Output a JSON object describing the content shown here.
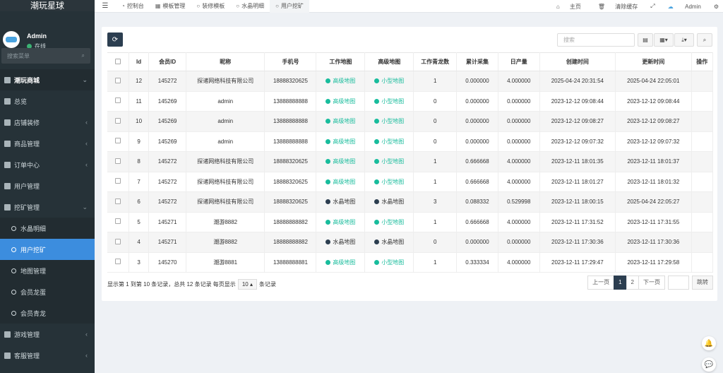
{
  "sidebar": {
    "logo": "潮玩星球",
    "user_name": "Admin",
    "user_status": "在线",
    "search_placeholder": "搜索菜单",
    "items": [
      {
        "label": "潮玩商城",
        "type": "head"
      },
      {
        "label": "总览",
        "type": "item"
      },
      {
        "label": "店铺装修",
        "type": "item"
      },
      {
        "label": "商品管理",
        "type": "item"
      },
      {
        "label": "订单中心",
        "type": "item"
      },
      {
        "label": "用户管理",
        "type": "item"
      },
      {
        "label": "挖矿管理",
        "type": "item"
      },
      {
        "label": "水晶明细",
        "type": "sub"
      },
      {
        "label": "用户挖矿",
        "type": "sub-active"
      },
      {
        "label": "地图管理",
        "type": "sub"
      },
      {
        "label": "会员龙蛋",
        "type": "sub"
      },
      {
        "label": "会员青龙",
        "type": "sub"
      },
      {
        "label": "游戏管理",
        "type": "item"
      },
      {
        "label": "客服管理",
        "type": "item"
      }
    ]
  },
  "topbar": {
    "tabs": [
      "控制台",
      "模板管理",
      "装修模板",
      "水晶明细",
      "用户挖矿"
    ],
    "home": "主页",
    "clear_cache": "清除缓存",
    "admin": "Admin"
  },
  "toolbar": {
    "search_placeholder": "搜索"
  },
  "table": {
    "headers": [
      "Id",
      "会员ID",
      "昵称",
      "手机号",
      "工作地图",
      "高级地图",
      "工作青龙数",
      "累计采集",
      "日产量",
      "创建时间",
      "更新时间",
      "操作"
    ],
    "rows": [
      {
        "id": "12",
        "member": "145272",
        "nick": "探诸网络科技有限公司",
        "phone": "18888320625",
        "work_map": "高级地图",
        "work_map_color": "green",
        "adv_map": "小型地图",
        "adv_map_color": "green",
        "count": "1",
        "total": "0.000000",
        "daily": "4.000000",
        "created": "2025-04-24 20:31:54",
        "updated": "2025-04-24 22:05:01"
      },
      {
        "id": "11",
        "member": "145269",
        "nick": "admin",
        "phone": "13888888888",
        "work_map": "高级地图",
        "work_map_color": "green",
        "adv_map": "小型地图",
        "adv_map_color": "green",
        "count": "0",
        "total": "0.000000",
        "daily": "0.000000",
        "created": "2023-12-12 09:08:44",
        "updated": "2023-12-12 09:08:44"
      },
      {
        "id": "10",
        "member": "145269",
        "nick": "admin",
        "phone": "13888888888",
        "work_map": "高级地图",
        "work_map_color": "green",
        "adv_map": "小型地图",
        "adv_map_color": "green",
        "count": "0",
        "total": "0.000000",
        "daily": "0.000000",
        "created": "2023-12-12 09:08:27",
        "updated": "2023-12-12 09:08:27"
      },
      {
        "id": "9",
        "member": "145269",
        "nick": "admin",
        "phone": "13888888888",
        "work_map": "高级地图",
        "work_map_color": "green",
        "adv_map": "小型地图",
        "adv_map_color": "green",
        "count": "0",
        "total": "0.000000",
        "daily": "0.000000",
        "created": "2023-12-12 09:07:32",
        "updated": "2023-12-12 09:07:32"
      },
      {
        "id": "8",
        "member": "145272",
        "nick": "探诸网络科技有限公司",
        "phone": "18888320625",
        "work_map": "高级地图",
        "work_map_color": "green",
        "adv_map": "小型地图",
        "adv_map_color": "green",
        "count": "1",
        "total": "0.666668",
        "daily": "4.000000",
        "created": "2023-12-11 18:01:35",
        "updated": "2023-12-11 18:01:37"
      },
      {
        "id": "7",
        "member": "145272",
        "nick": "探诸网络科技有限公司",
        "phone": "18888320625",
        "work_map": "高级地图",
        "work_map_color": "green",
        "adv_map": "小型地图",
        "adv_map_color": "green",
        "count": "1",
        "total": "0.666668",
        "daily": "4.000000",
        "created": "2023-12-11 18:01:27",
        "updated": "2023-12-11 18:01:32"
      },
      {
        "id": "6",
        "member": "145272",
        "nick": "探诸网络科技有限公司",
        "phone": "18888320625",
        "work_map": "水晶地图",
        "work_map_color": "dark",
        "adv_map": "水晶地图",
        "adv_map_color": "dark",
        "count": "3",
        "total": "0.088332",
        "daily": "0.529998",
        "created": "2023-12-11 18:00:15",
        "updated": "2025-04-24 22:05:27"
      },
      {
        "id": "5",
        "member": "145271",
        "nick": "潮游8882",
        "phone": "18888888882",
        "work_map": "高级地图",
        "work_map_color": "green",
        "adv_map": "小型地图",
        "adv_map_color": "green",
        "count": "1",
        "total": "0.666668",
        "daily": "4.000000",
        "created": "2023-12-11 17:31:52",
        "updated": "2023-12-11 17:31:55"
      },
      {
        "id": "4",
        "member": "145271",
        "nick": "潮游8882",
        "phone": "18888888882",
        "work_map": "水晶地图",
        "work_map_color": "dark",
        "adv_map": "水晶地图",
        "adv_map_color": "dark",
        "count": "0",
        "total": "0.000000",
        "daily": "0.000000",
        "created": "2023-12-11 17:30:36",
        "updated": "2023-12-11 17:30:36"
      },
      {
        "id": "3",
        "member": "145270",
        "nick": "潮游8881",
        "phone": "13888888881",
        "work_map": "高级地图",
        "work_map_color": "green",
        "adv_map": "小型地图",
        "adv_map_color": "green",
        "count": "1",
        "total": "0.333334",
        "daily": "4.000000",
        "created": "2023-12-11 17:29:47",
        "updated": "2023-12-11 17:29:58"
      }
    ]
  },
  "footer": {
    "summary": "显示第 1 到第 10 条记录，总共 12 条记录 每页显示",
    "page_size": "10",
    "suffix": "条记录",
    "prev": "上一页",
    "pages": [
      "1",
      "2"
    ],
    "next": "下一页",
    "jump": "跳转"
  },
  "colors": {
    "accent": "#3c8dde",
    "dark_button": "#2c3e50",
    "success": "#18bc9c"
  }
}
